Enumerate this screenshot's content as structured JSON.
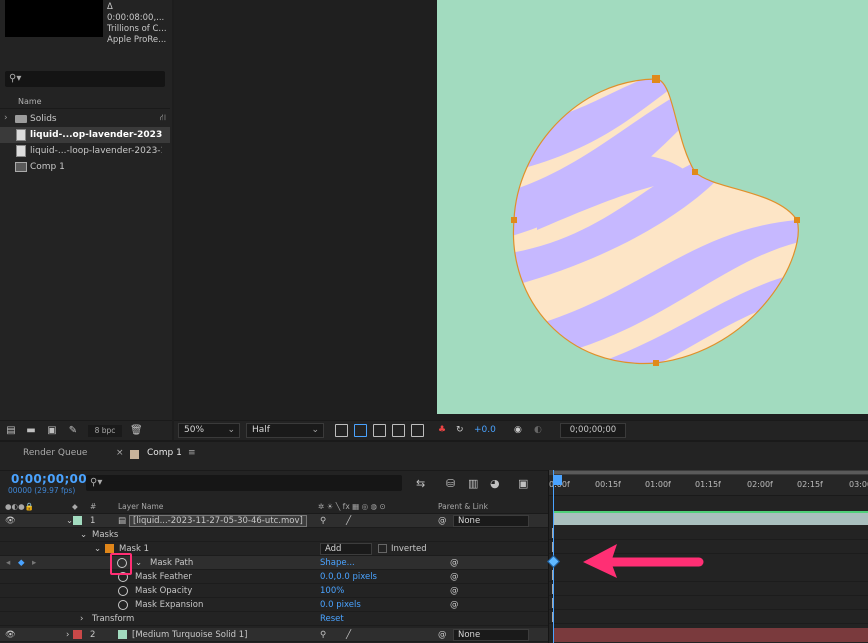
{
  "project": {
    "footage_info": [
      "Δ 0:00:08:00,...",
      "Trillions of C...",
      "Apple ProRe..."
    ],
    "search_placeholder": "",
    "column_name": "Name",
    "items": [
      {
        "label": "Solids",
        "type": "folder"
      },
      {
        "label": "liquid-...op-lavender-2023-1",
        "type": "footage",
        "selected": true
      },
      {
        "label": "liquid-...-loop-lavender-2023-1",
        "type": "footage"
      },
      {
        "label": "Comp 1",
        "type": "comp"
      }
    ],
    "bpc": "8 bpc"
  },
  "viewer": {
    "zoom": "50%",
    "resolution": "Half",
    "exposure": "+0.0",
    "timecode": "0;00;00;00",
    "bg_color": "#a2dbbf"
  },
  "timeline": {
    "tabs": [
      "Render Queue",
      "Comp 1"
    ],
    "current_time": "0;00;00;00",
    "fps": "00000 (29.97 fps)",
    "columns": {
      "layer_name": "Layer Name",
      "parent": "Parent & Link"
    },
    "layers": [
      {
        "num": "1",
        "name": "[liquid...-2023-11-27-05-30-46-utc.mov]",
        "parent": "None"
      },
      {
        "num": "2",
        "name": "[Medium Turquoise Solid 1]",
        "parent": "None"
      }
    ],
    "masks_label": "Masks",
    "mask1": {
      "name": "Mask 1",
      "mode": "Add",
      "inverted": "Inverted"
    },
    "properties": [
      {
        "name": "Mask Path",
        "value": "Shape..."
      },
      {
        "name": "Mask Feather",
        "value": "0.0,0.0 pixels"
      },
      {
        "name": "Mask Opacity",
        "value": "100%"
      },
      {
        "name": "Mask Expansion",
        "value": "0.0 pixels"
      }
    ],
    "transform": {
      "label": "Transform",
      "value": "Reset"
    },
    "ruler_labels": [
      "0:00f",
      "00:15f",
      "01:00f",
      "01:15f",
      "02:00f",
      "02:15f",
      "03:00"
    ]
  }
}
